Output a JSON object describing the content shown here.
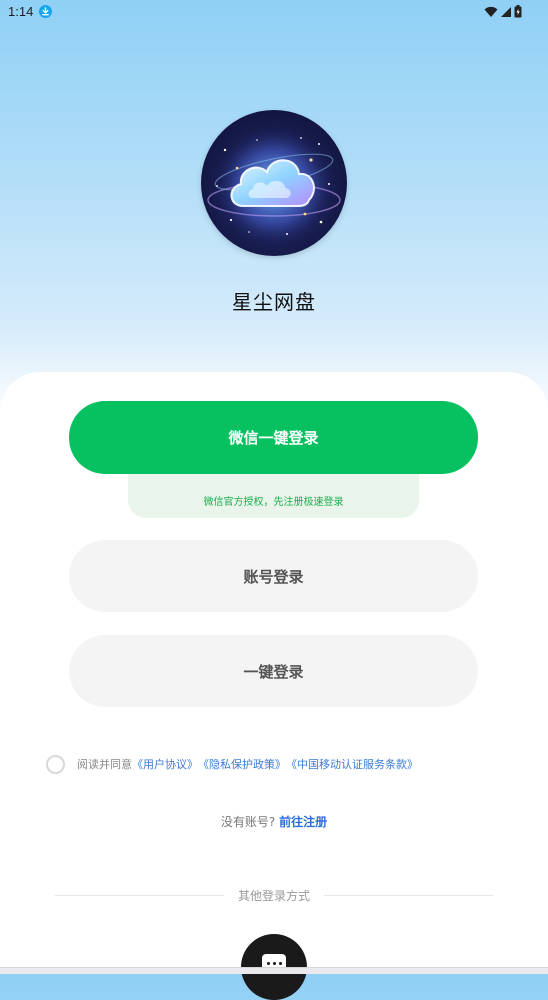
{
  "status_bar": {
    "time": "1:14",
    "icons": [
      "download-icon",
      "wifi-icon",
      "signal-icon",
      "battery-icon"
    ]
  },
  "app": {
    "name": "星尘网盘",
    "logo": "cloud-galaxy-logo"
  },
  "buttons": {
    "wechat_login": "微信一键登录",
    "wechat_hint": "微信官方授权，先注册极速登录",
    "account_login": "账号登录",
    "onekey_login": "一键登录"
  },
  "agreement": {
    "prefix": "阅读并同意",
    "user_agreement": "《用户协议》",
    "privacy_policy": "《隐私保护政策》",
    "cmcc_terms": "《中国移动认证服务条款》"
  },
  "register": {
    "question": "没有账号?",
    "link": "前往注册"
  },
  "other_login": {
    "label": "其他登录方式",
    "more_icon": "more-icon"
  },
  "colors": {
    "wechat_green": "#07c160",
    "link_blue": "#3a7bd5",
    "header_gradient_top": "#8fd0f5"
  }
}
